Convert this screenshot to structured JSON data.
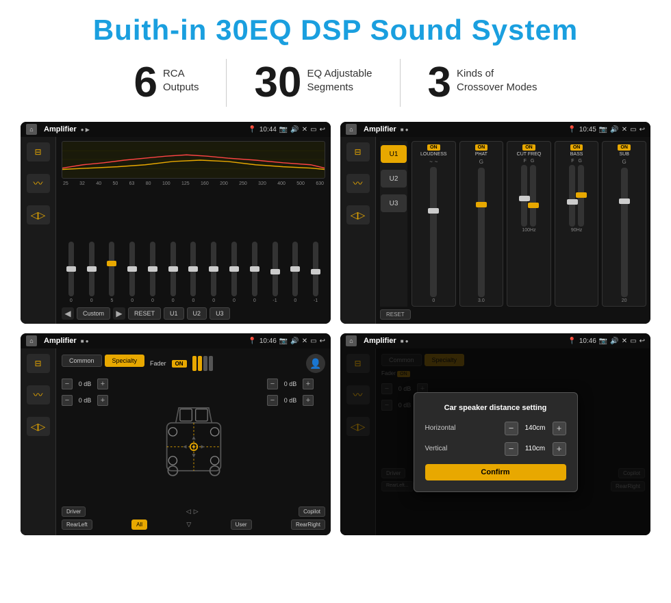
{
  "title": "Buith-in 30EQ DSP Sound System",
  "stats": [
    {
      "number": "6",
      "label": "RCA\nOutputs"
    },
    {
      "number": "30",
      "label": "EQ Adjustable\nSegments"
    },
    {
      "number": "3",
      "label": "Kinds of\nCrossover Modes"
    }
  ],
  "screens": [
    {
      "id": "screen1",
      "time": "10:44",
      "app": "Amplifier",
      "freq_labels": [
        "25",
        "32",
        "40",
        "50",
        "63",
        "80",
        "100",
        "125",
        "160",
        "200",
        "250",
        "320",
        "400",
        "500",
        "630"
      ],
      "slider_vals": [
        "0",
        "0",
        "0",
        "5",
        "0",
        "0",
        "0",
        "0",
        "0",
        "0",
        "0",
        "-1",
        "0",
        "-1"
      ],
      "bottom_btns": [
        "Custom",
        "RESET",
        "U1",
        "U2",
        "U3"
      ]
    },
    {
      "id": "screen2",
      "time": "10:45",
      "app": "Amplifier",
      "u_btns": [
        "U1",
        "U2",
        "U3"
      ],
      "modules": [
        "LOUDNESS",
        "PHAT",
        "CUT FREQ",
        "BASS",
        "SUB"
      ]
    },
    {
      "id": "screen3",
      "time": "10:46",
      "app": "Amplifier",
      "tabs": [
        "Common",
        "Specialty"
      ],
      "fader_label": "Fader",
      "db_vals": [
        "0 dB",
        "0 dB",
        "0 dB",
        "0 dB"
      ],
      "bottom_btns": [
        "Driver",
        "",
        "Copilot",
        "RearLeft",
        "All",
        "",
        "User",
        "RearRight"
      ]
    },
    {
      "id": "screen4",
      "time": "10:46",
      "app": "Amplifier",
      "dialog": {
        "title": "Car speaker distance setting",
        "horizontal_label": "Horizontal",
        "horizontal_val": "140cm",
        "vertical_label": "Vertical",
        "vertical_val": "110cm",
        "confirm_label": "Confirm",
        "db_vals": [
          "0 dB",
          "0 dB"
        ]
      }
    }
  ]
}
